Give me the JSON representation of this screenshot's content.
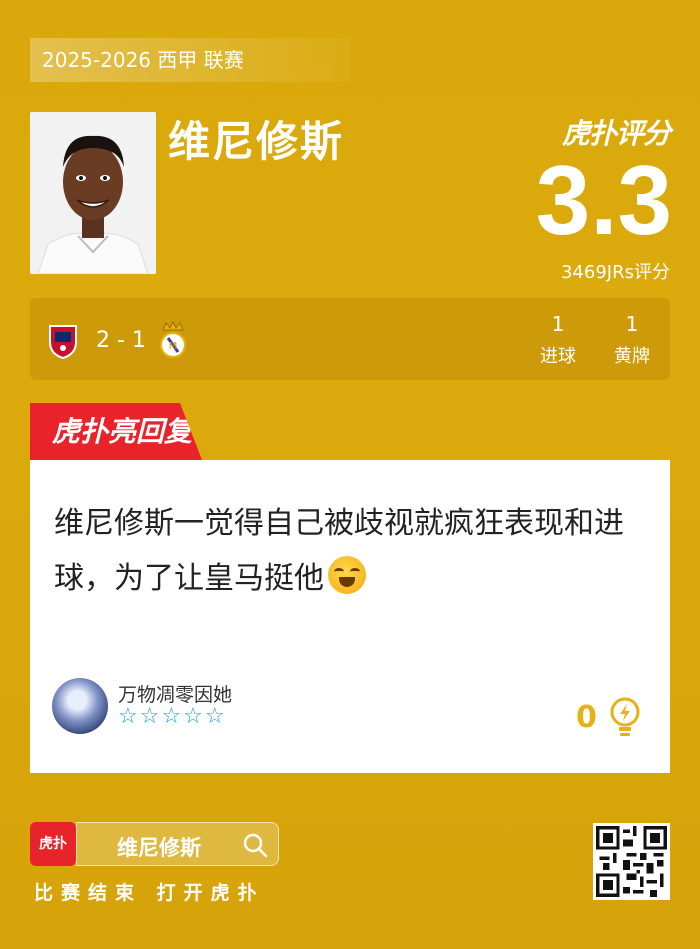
{
  "header": {
    "league": "2025-2026 西甲 联赛",
    "player_name": "维尼修斯",
    "brand": "虎扑评分",
    "rating": "3.3",
    "rating_count": "3469JRs评分"
  },
  "match": {
    "score": "2 - 1",
    "home_team": "osasuna-crest",
    "away_team": "real-madrid-crest",
    "stats": [
      {
        "value": "1",
        "label": "进球"
      },
      {
        "value": "1",
        "label": "黄牌"
      }
    ]
  },
  "comment": {
    "tag": "虎扑亮回复",
    "text": "维尼修斯一觉得自己被歧视就疯狂表现和进球，为了让皇马挺他",
    "emoji": "laughing-crying-emoji",
    "username": "万物凋零因她",
    "stars": "☆☆☆☆☆",
    "likes": "0"
  },
  "footer": {
    "app_logo": "虎扑",
    "search_text": "维尼修斯",
    "cta": "比赛结束 打开虎扑"
  },
  "colors": {
    "background": "#dcaa0d",
    "accent_red": "#e8232a",
    "star_blue": "#1aa3d9",
    "like_gold": "#e7b217"
  }
}
